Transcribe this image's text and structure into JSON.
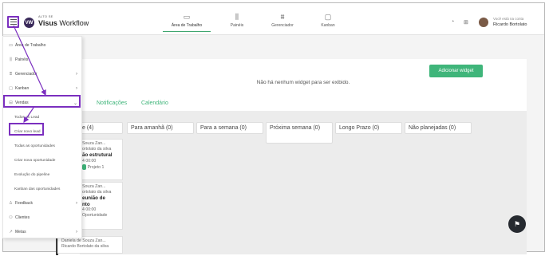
{
  "app": {
    "logo_mark": "VW",
    "logo_small": "ALTO SE",
    "logo_name_bold": "Visus",
    "logo_name_rest": " Workflow"
  },
  "nav": {
    "tabs": [
      {
        "label": "Área de Trabalho",
        "icon": "monitor-icon"
      },
      {
        "label": "Painéis",
        "icon": "bar-chart-icon"
      },
      {
        "label": "Gerenciador",
        "icon": "org-chart-icon"
      },
      {
        "label": "Kanban",
        "icon": "chat-icon"
      }
    ]
  },
  "user": {
    "greeting": "Você está na conta",
    "name": "Ricardo Bortolato"
  },
  "dashboard": {
    "add_widget": "Adicionar widget",
    "empty_message": "Não há nenhum widget para ser exibido.",
    "tabs": [
      "Notificações",
      "Calendário"
    ]
  },
  "kanban": {
    "columns": [
      {
        "label": "e (4)"
      },
      {
        "label": "Para amanhã (0)"
      },
      {
        "label": "Para a semana (0)"
      },
      {
        "label": "Próxima semana (0)"
      },
      {
        "label": "Longo Prazo (0)"
      },
      {
        "label": "Não planejadas (0)"
      }
    ],
    "cards": [
      {
        "name": "Souza Zan...",
        "owner": "ortolato da silva",
        "title": "ão estrutural",
        "time": "4 00:00",
        "badge": "Projeto 1"
      },
      {
        "name": "Souza Zan...",
        "owner": "ortolato da silva",
        "title": "eunião de",
        "title2": "nto",
        "time": "4 00:00",
        "tag": "Oportunidade"
      },
      {
        "name": "Daniela de Souza Zan...",
        "owner": "Ricardo Bortolato da silva"
      }
    ]
  },
  "menu": {
    "items": [
      {
        "label": "Área de Trabalho",
        "icon": "monitor-icon"
      },
      {
        "label": "Painéis",
        "icon": "bar-chart-icon"
      },
      {
        "label": "Gerenciador",
        "icon": "org-chart-icon"
      },
      {
        "label": "Kanban",
        "icon": "chat-icon"
      },
      {
        "label": "Vendas",
        "icon": "cart-icon"
      },
      {
        "label": "Todos os Lead"
      },
      {
        "label": "Criar novo lead"
      },
      {
        "label": "Todas as oportunidades"
      },
      {
        "label": "Criar nova oportunidade"
      },
      {
        "label": "Evolução do pipeline"
      },
      {
        "label": "Kanban das oportunidades"
      },
      {
        "label": "Feedback",
        "icon": "thumbs-up-icon"
      },
      {
        "label": "Clientes",
        "icon": "users-icon"
      },
      {
        "label": "Metas",
        "icon": "target-icon"
      }
    ]
  },
  "colors": {
    "accent": "#3fb57a",
    "highlight": "#7b2fbf"
  }
}
